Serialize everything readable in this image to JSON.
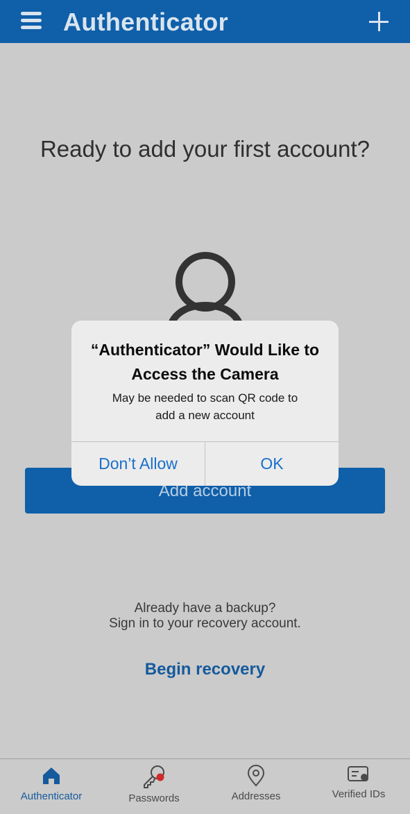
{
  "header": {
    "title": "Authenticator",
    "menu_icon": "hamburger-menu-icon",
    "add_icon": "plus-icon",
    "color": "#0f5fa9"
  },
  "main": {
    "headline": "Ready to add your first account?",
    "avatar_icon": "person-icon",
    "add_account_label": "Add account",
    "backup_line1": "Already have a backup?",
    "backup_line2": "Sign in to your recovery account.",
    "recovery_link": "Begin recovery"
  },
  "dialog": {
    "title_line1": "“Authenticator” Would Like to",
    "title_line2": "Access the Camera",
    "message_line1": "May be needed to scan QR code to",
    "message_line2": "add a new account",
    "deny_label": "Don’t Allow",
    "allow_label": "OK",
    "button_color": "#1a6fc9"
  },
  "tabs": [
    {
      "label": "Authenticator",
      "icon": "home-icon",
      "active": true
    },
    {
      "label": "Passwords",
      "icon": "key-icon",
      "active": false
    },
    {
      "label": "Addresses",
      "icon": "location-pin-icon",
      "active": false
    },
    {
      "label": "Verified IDs",
      "icon": "id-card-icon",
      "active": false
    }
  ]
}
